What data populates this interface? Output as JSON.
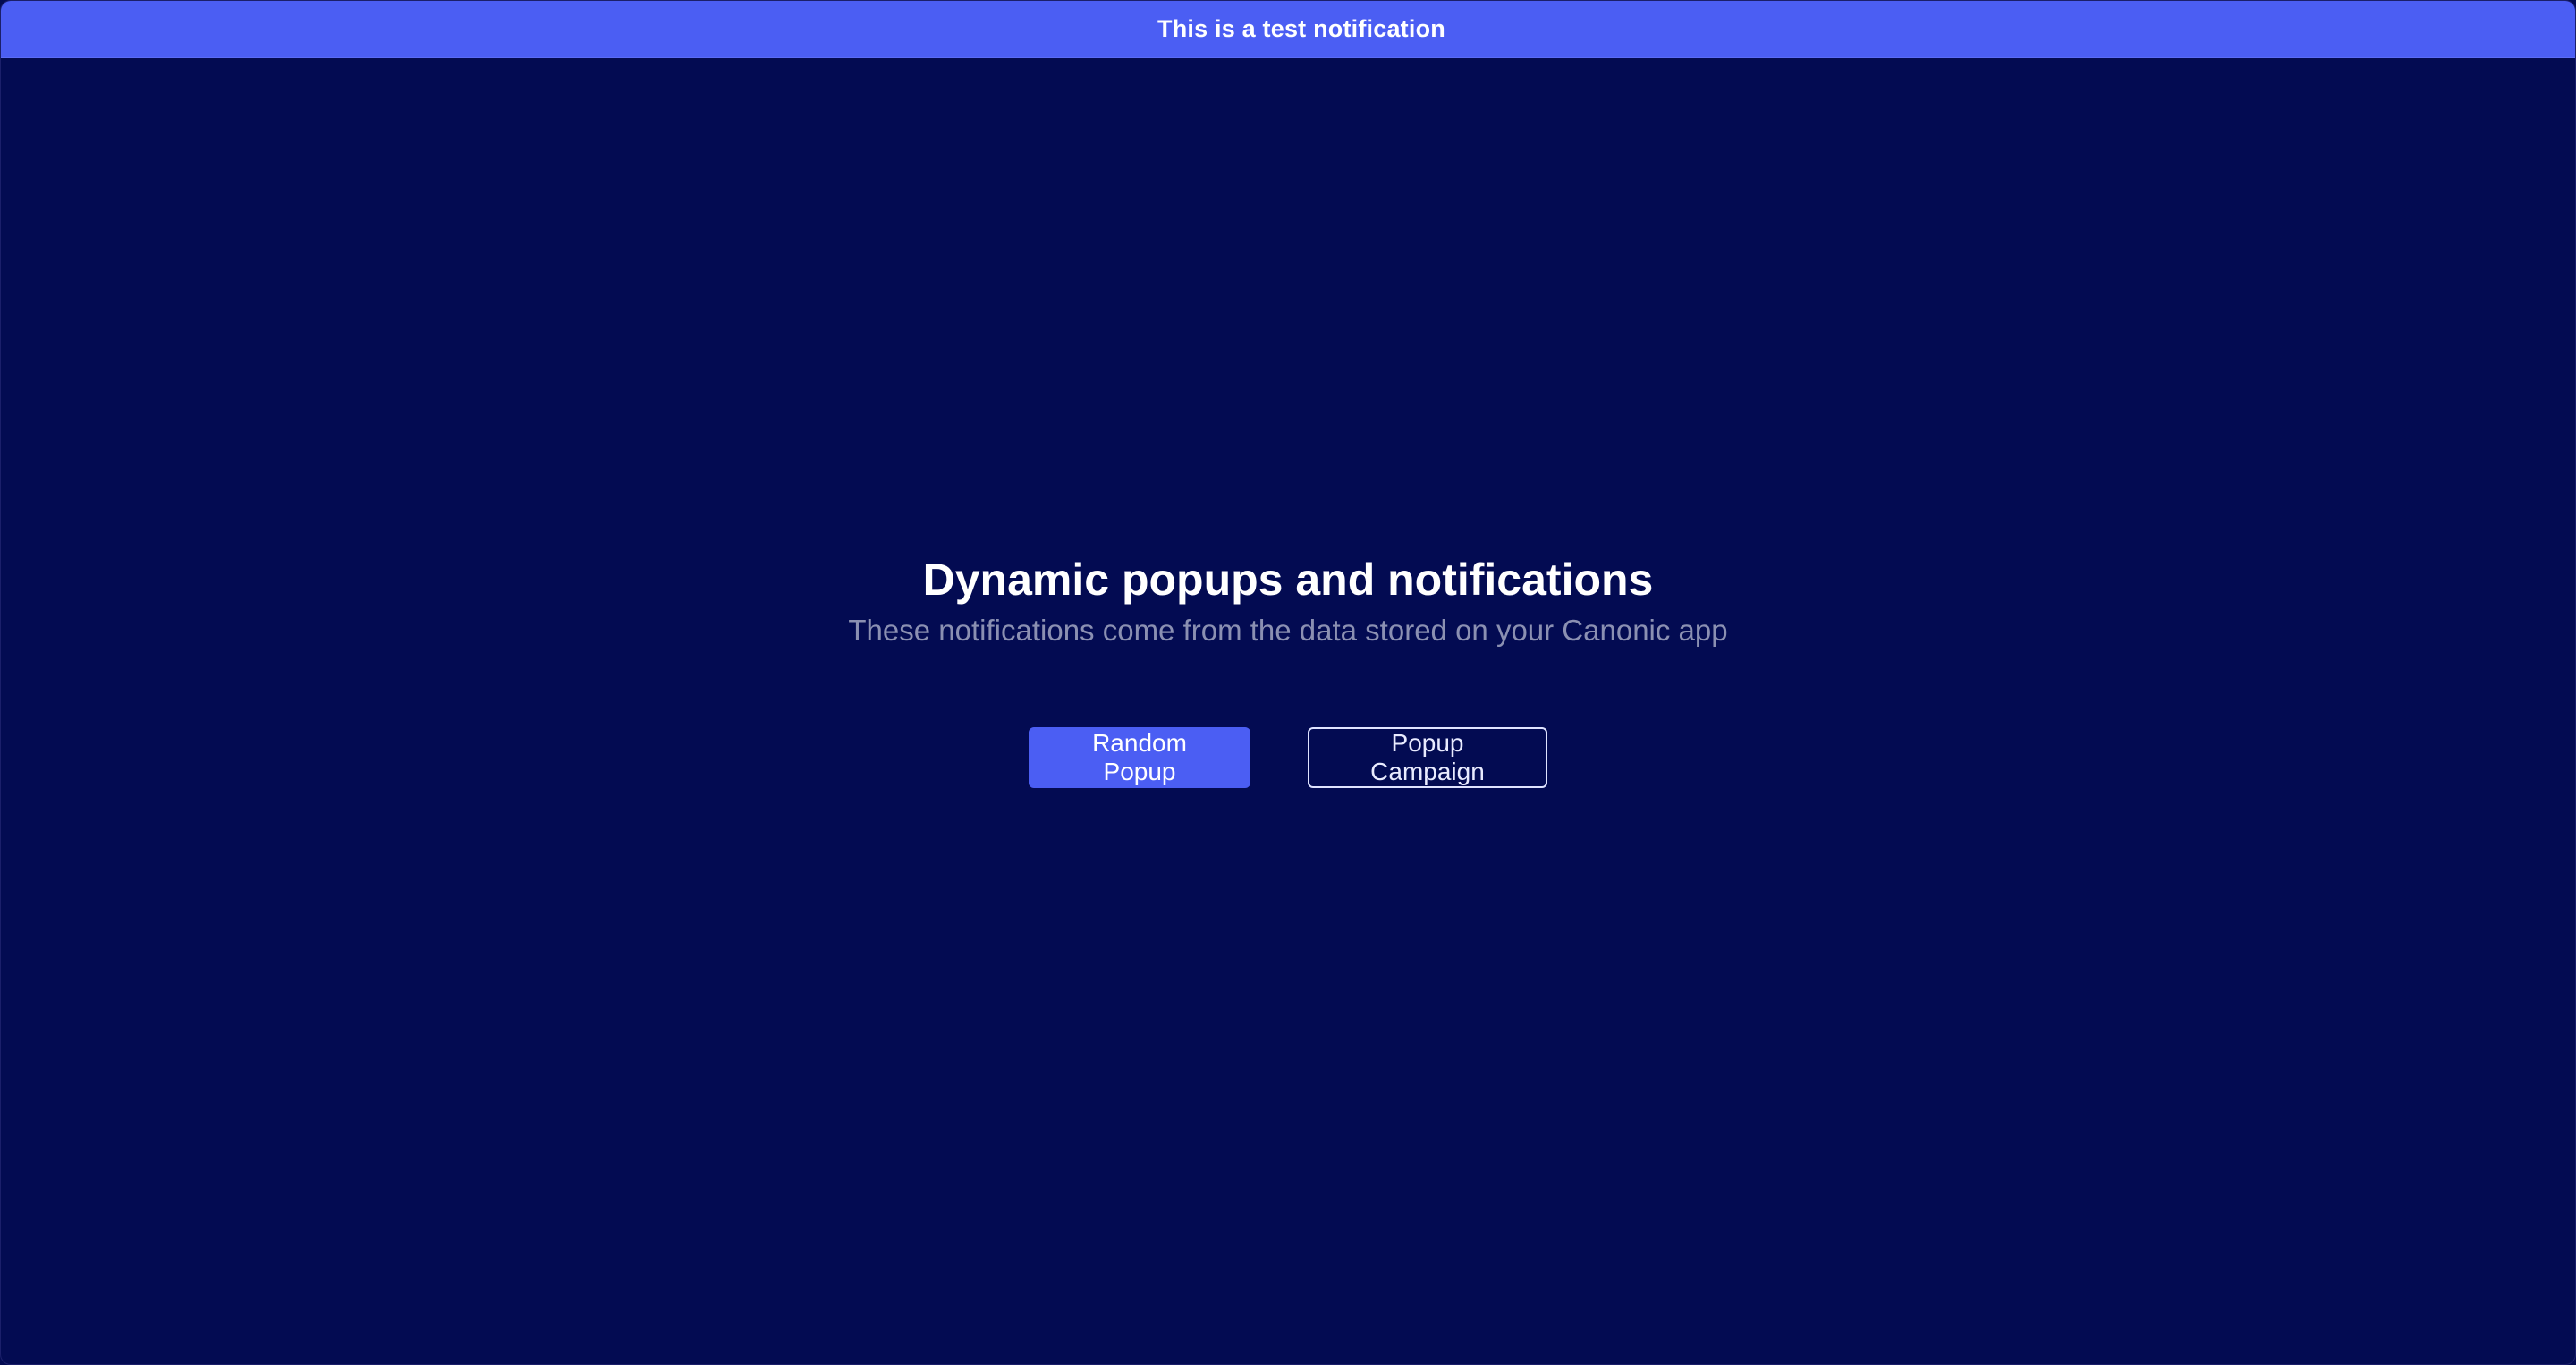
{
  "notification": {
    "text": "This is a test notification"
  },
  "hero": {
    "title": "Dynamic popups and notifications",
    "subtitle": "These notifications come from the data stored on your Canonic app"
  },
  "actions": {
    "random_popup_label": "Random Popup",
    "popup_campaign_label": "Popup Campaign"
  },
  "colors": {
    "background": "#030b52",
    "accent": "#4b5ef3",
    "title": "#ffffff",
    "subtitle": "#8b90b2"
  }
}
